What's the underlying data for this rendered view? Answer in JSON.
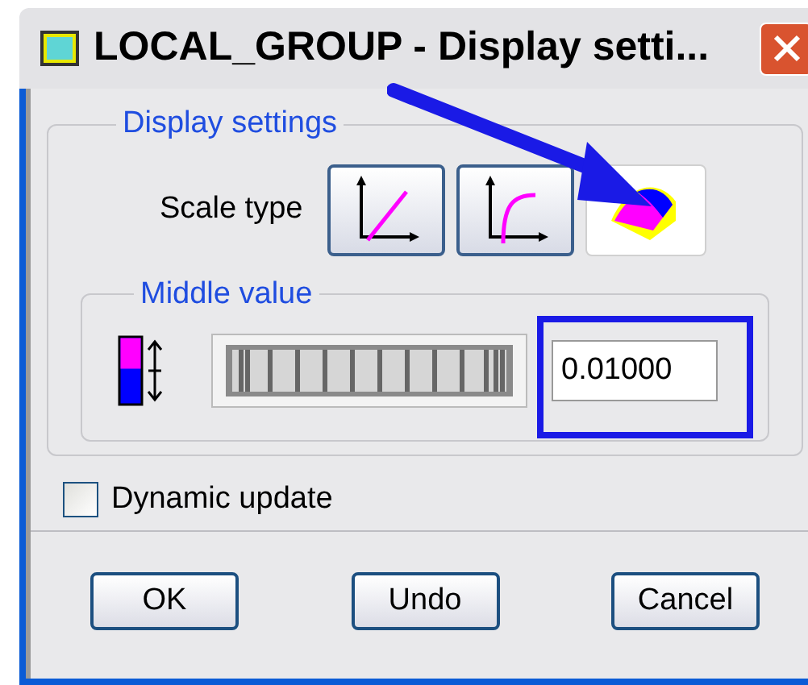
{
  "window": {
    "title": "LOCAL_GROUP - Display setti..."
  },
  "display_settings": {
    "title": "Display settings",
    "scale_type_label": "Scale type",
    "scale_types": [
      {
        "kind": "linear",
        "selected": false
      },
      {
        "kind": "log",
        "selected": false
      },
      {
        "kind": "surface",
        "selected": true
      }
    ]
  },
  "middle_value": {
    "title": "Middle value",
    "value": "0.01000"
  },
  "dynamic_update": {
    "label": "Dynamic update",
    "checked": false
  },
  "buttons": [
    "OK",
    "Undo",
    "Cancel"
  ]
}
